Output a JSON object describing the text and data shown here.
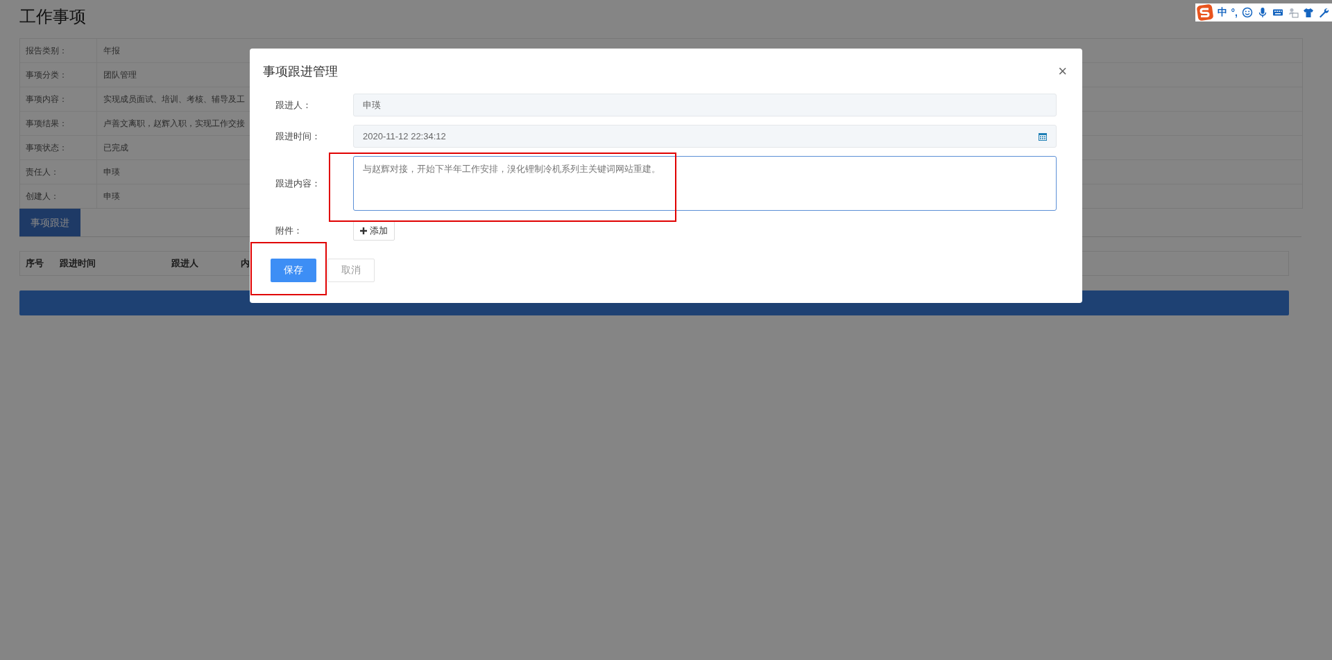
{
  "page": {
    "title": "工作事项"
  },
  "details": [
    {
      "label": "报告类别：",
      "value": "年报"
    },
    {
      "label": "事项分类：",
      "value": "团队管理"
    },
    {
      "label": "事项内容：",
      "value": "实现成员面试、培训、考核、辅导及工"
    },
    {
      "label": "事项结果：",
      "value": "卢善文离职，赵辉入职，实现工作交接"
    },
    {
      "label": "事项状态：",
      "value": "已完成"
    },
    {
      "label": "责任人：",
      "value": "申瑛"
    },
    {
      "label": "创建人：",
      "value": "申瑛"
    }
  ],
  "tabs": [
    {
      "label": "事项跟进",
      "selected": true
    }
  ],
  "follow_table": {
    "columns": [
      "序号",
      "跟进时间",
      "跟进人",
      "内"
    ]
  },
  "dialog": {
    "title": "事项跟进管理",
    "close": "×",
    "fields": [
      {
        "kind": "text",
        "label": "跟进人：",
        "value": "申瑛",
        "disabled": true
      },
      {
        "kind": "date",
        "label": "跟进时间：",
        "value": "2020-11-12 22:34:12",
        "disabled": true
      },
      {
        "kind": "textarea",
        "label": "跟进内容：",
        "value": "与赵辉对接，开始下半年工作安排，溴化锂制冷机系列主关键词网站重建。",
        "disabled": false
      }
    ],
    "attachment": {
      "label": "附件：",
      "button": "添加"
    },
    "buttons": [
      {
        "kind": "primary",
        "label": "保存"
      },
      {
        "kind": "default",
        "label": "取消"
      }
    ]
  },
  "ime_toolbar": {
    "mode": "中",
    "punctuation": "°,"
  }
}
